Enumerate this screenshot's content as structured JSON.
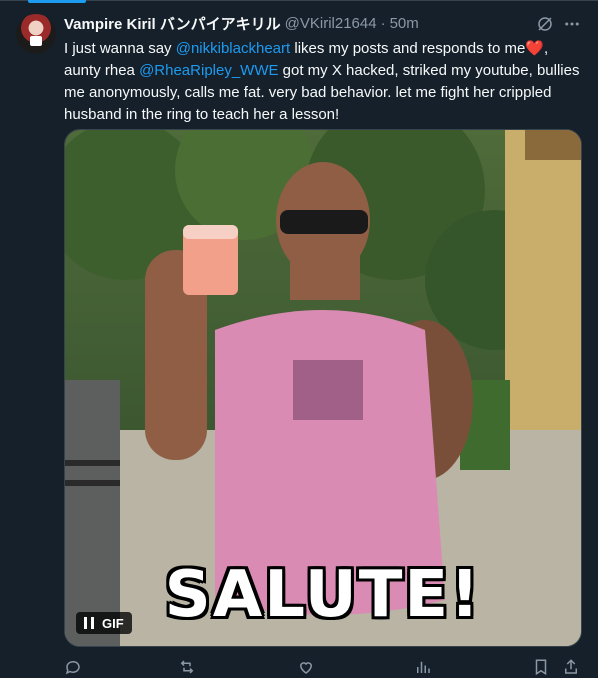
{
  "tweet": {
    "display_name": "Vampire Kiril バンパイアキリル",
    "handle": "@VKiril21644",
    "separator": "·",
    "time": "50m",
    "text": {
      "p1": "I just wanna say ",
      "mention1": "@nikkiblackheart",
      "p2": " likes my posts and responds to me",
      "heart": "❤️",
      "p3": ", aunty rhea ",
      "mention2": "@RheaRipley_WWE",
      "p4": " got my X hacked, striked my youtube, bullies me anonymously, calls me fat. very bad behavior. let me fight her crippled husband in the ring to teach her a lesson!"
    }
  },
  "media": {
    "caption": "SALUTE!",
    "gif_badge": "GIF"
  },
  "colors": {
    "background": "#15202b",
    "accent": "#1d9bf0",
    "muted": "#8b98a5",
    "heart": "#f91880"
  },
  "icons": [
    "grok-icon",
    "more-icon",
    "pause-icon",
    "reply-icon",
    "repost-icon",
    "like-icon",
    "views-icon",
    "bookmark-icon",
    "share-icon"
  ]
}
